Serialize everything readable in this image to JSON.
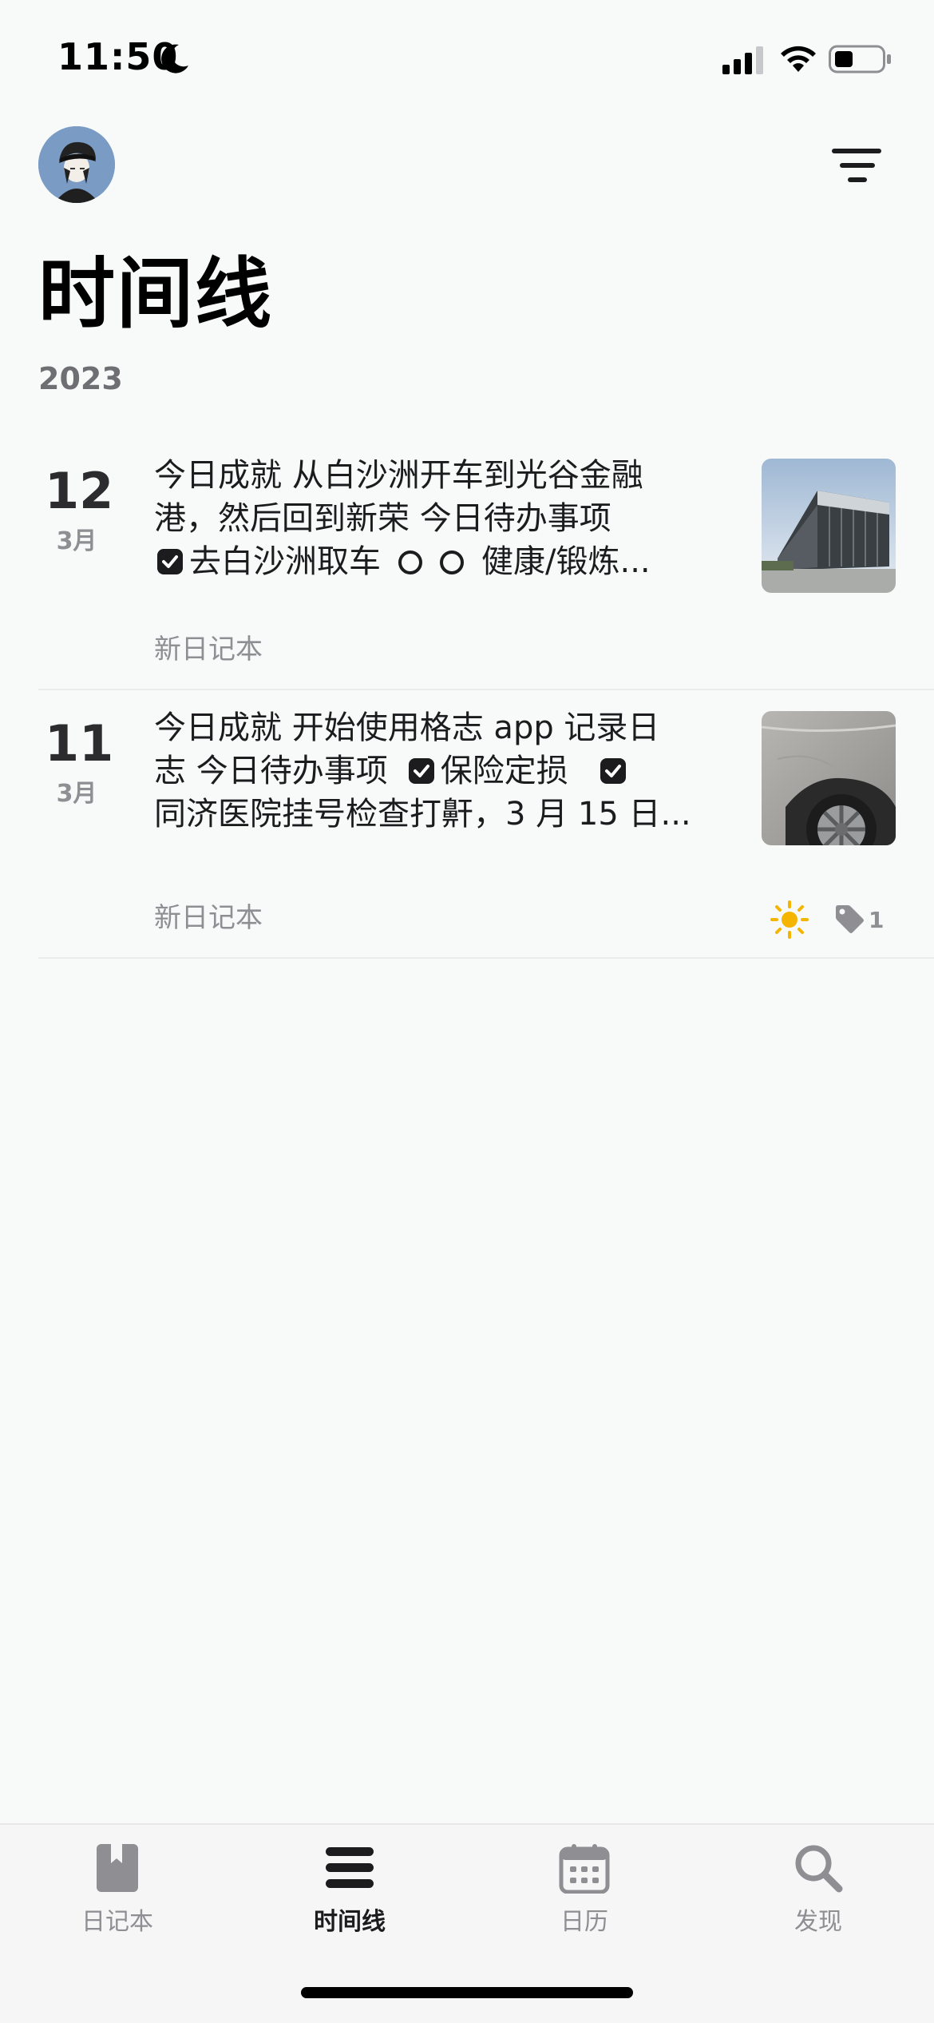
{
  "status_bar": {
    "time": "11:50"
  },
  "header": {
    "title": "时间线",
    "year": "2023"
  },
  "entries": [
    {
      "day": "12",
      "month": "3月",
      "line1": "今日成就  从白沙洲开车到光谷金融",
      "line2": "港，然后回到新荣  今日待办事项",
      "line3_a": "去白沙洲取车",
      "line3_b": "健康/锻炼...",
      "notebook": "新日记本"
    },
    {
      "day": "11",
      "month": "3月",
      "line1": "今日成就  开始使用格志 app 记录日",
      "line2_a": "志  今日待办事项",
      "line2_b": "保险定损",
      "line3": "同济医院挂号检查打鼾，3 月 15 日...",
      "notebook": "新日记本",
      "tag_count": "1"
    }
  ],
  "tab_bar": {
    "tabs": [
      {
        "label": "日记本",
        "icon": "book-icon"
      },
      {
        "label": "时间线",
        "icon": "timeline-icon",
        "active": true
      },
      {
        "label": "日历",
        "icon": "calendar-icon"
      },
      {
        "label": "发现",
        "icon": "search-icon"
      }
    ]
  },
  "colors": {
    "background": "#f8fafa",
    "text": "#1c1c1e",
    "muted": "#8e8e93",
    "sun": "#f5b400"
  }
}
